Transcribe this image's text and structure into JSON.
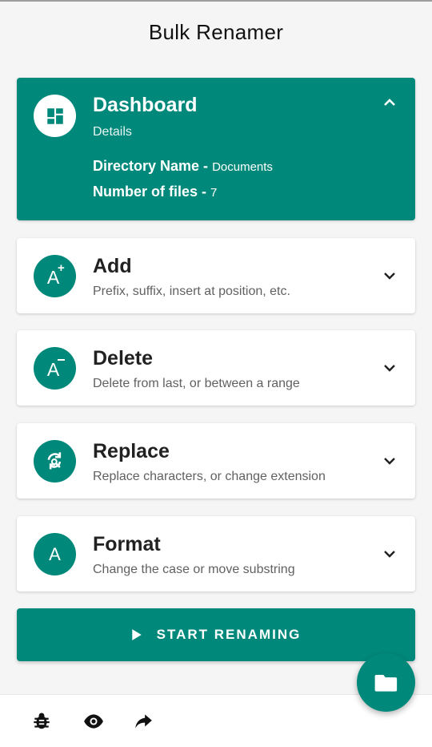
{
  "app": {
    "title": "Bulk Renamer"
  },
  "colors": {
    "accent": "#00897b",
    "background": "#f5f5f5",
    "card": "#ffffff"
  },
  "dashboard": {
    "title": "Dashboard",
    "subtitle": "Details",
    "directory_label": "Directory Name - ",
    "directory_value": "Documents",
    "files_label": "Number of files - ",
    "files_value": "7",
    "icon": "dashboard-icon"
  },
  "sections": [
    {
      "title": "Add",
      "subtitle": "Prefix, suffix, insert at position, etc.",
      "icon": "add-text-icon",
      "avatar_text": "A"
    },
    {
      "title": "Delete",
      "subtitle": "Delete from last, or between a range",
      "icon": "delete-text-icon",
      "avatar_text": "A"
    },
    {
      "title": "Replace",
      "subtitle": "Replace characters, or change extension",
      "icon": "replace-icon"
    },
    {
      "title": "Format",
      "subtitle": "Change the case or move substring",
      "icon": "format-icon",
      "avatar_text": "A"
    }
  ],
  "start_button": {
    "label": "START RENAMING",
    "icon": "play-icon"
  },
  "bottom_bar": {
    "icons": [
      "bug-icon",
      "eye-icon",
      "share-icon"
    ]
  },
  "fab": {
    "icon": "folder-icon"
  }
}
